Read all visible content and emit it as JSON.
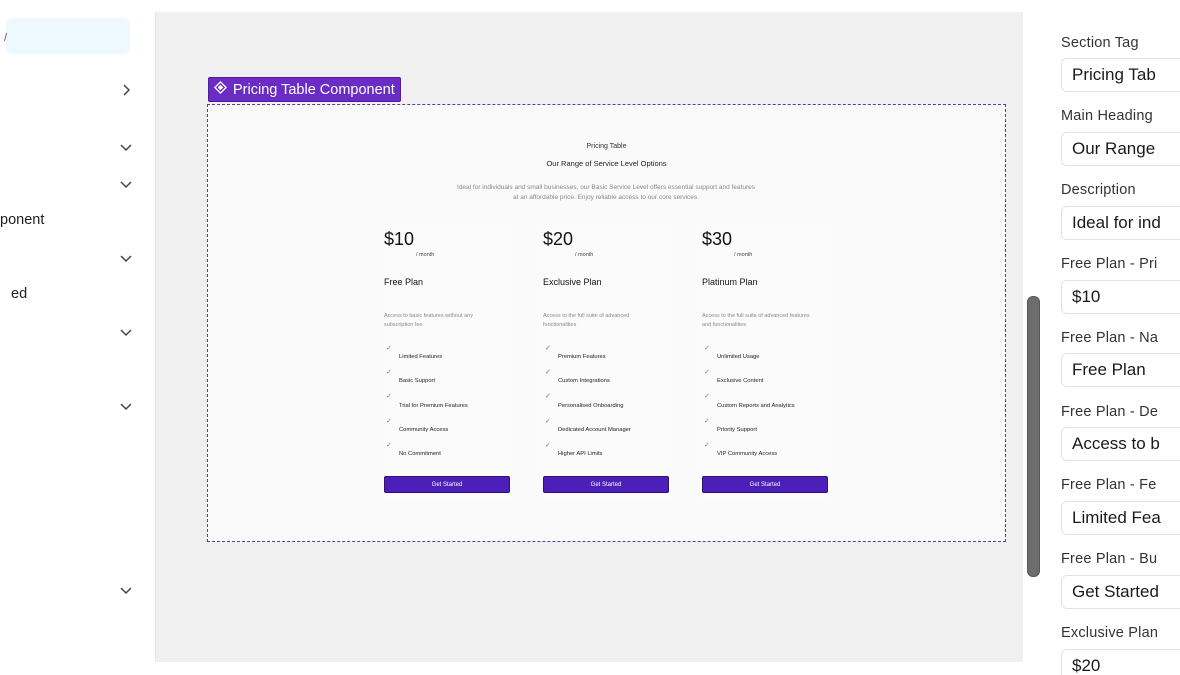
{
  "sidebar": {
    "items": [
      {
        "label": "ponent"
      },
      {
        "label": "ed"
      }
    ],
    "top_char": "/"
  },
  "canvas": {
    "component_label": "Pricing Table Component",
    "section_tag": "Pricing Table",
    "main_heading": "Our Range of Service Level Options",
    "description": "Ideal for individuals and small businesses, our Basic Service Level offers essential support and features at an affordable price. Enjoy reliable access to our core services.",
    "plans": [
      {
        "price": "$10",
        "per": "/ month",
        "name": "Free Plan",
        "description": "Access to basic features without any subscription fee",
        "features": [
          "Limited Features",
          "Basic Support",
          "Trial for Premium Features",
          "Community Access",
          "No Commitment"
        ],
        "button": "Get Started"
      },
      {
        "price": "$20",
        "per": "/ month",
        "name": "Exclusive Plan",
        "description": "Access to the full suite of advanced functionalities",
        "features": [
          "Premium Features",
          "Custom Integrations",
          "Personalised Onboarding",
          "Dedicated Account Manager",
          "Higher API Limits"
        ],
        "button": "Get Started"
      },
      {
        "price": "$30",
        "per": "/ month",
        "name": "Platinum Plan",
        "description": "Access to the full suite of advanced features and functionalities",
        "features": [
          "Unlimited Usage",
          "Exclusive Content",
          "Custom Reports and Analytics",
          "Priority Support",
          "VIP Community Access"
        ],
        "button": "Get Started"
      }
    ]
  },
  "properties": {
    "fields": [
      {
        "label": "Section Tag",
        "value": "Pricing Tab"
      },
      {
        "label": "Main Heading",
        "value": "Our Range"
      },
      {
        "label": "Description",
        "value": "Ideal for ind"
      },
      {
        "label": "Free Plan - Pri",
        "value": "$10"
      },
      {
        "label": "Free Plan - Na",
        "value": "Free Plan"
      },
      {
        "label": "Free Plan - De",
        "value": "Access to b"
      },
      {
        "label": "Free Plan - Fe",
        "value": "Limited Fea"
      },
      {
        "label": "Free Plan - Bu",
        "value": "Get Started"
      },
      {
        "label": "Exclusive Plan",
        "value": "$20"
      }
    ]
  },
  "colors": {
    "accent": "#6a2cc4",
    "button": "#4b1fb8"
  },
  "icons": {
    "component": "component-diamond-icon",
    "chevron_right": "chevron-right-icon",
    "chevron_down": "chevron-down-icon",
    "check": "check-icon"
  }
}
